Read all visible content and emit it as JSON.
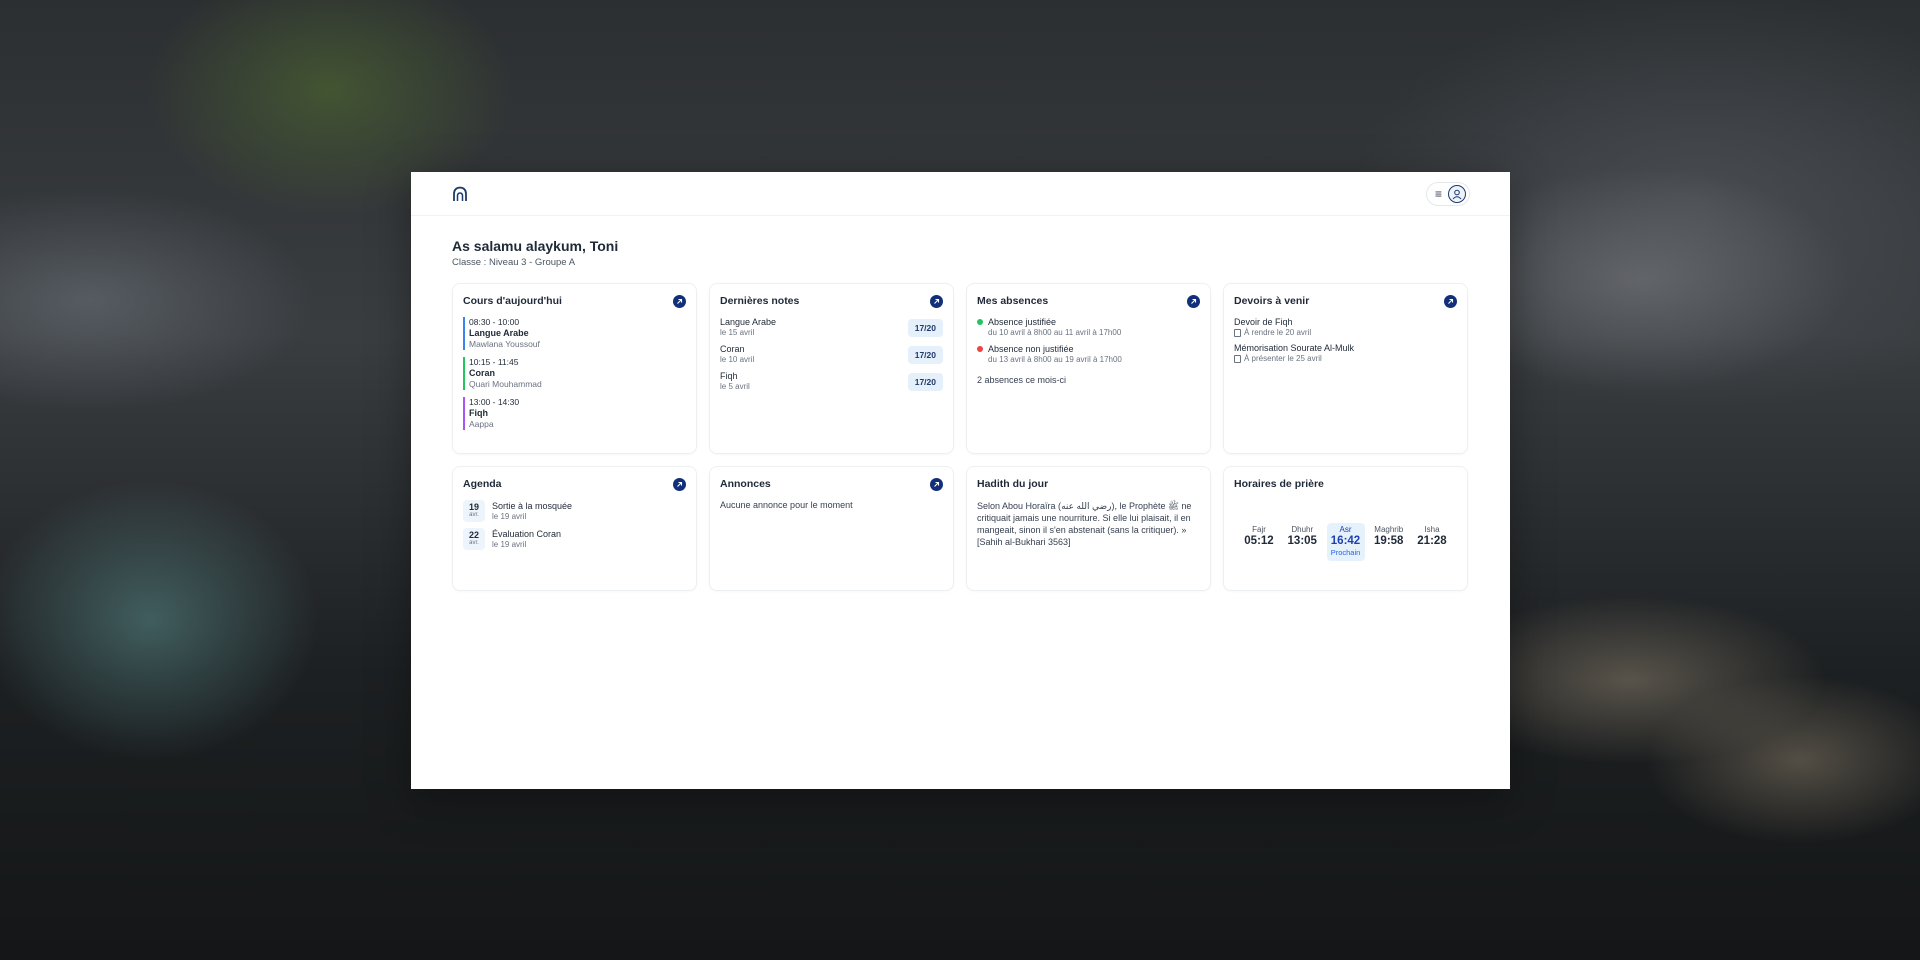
{
  "header": {
    "logo_icon": "mosque-arch-icon",
    "menu_icon": "hamburger-menu-icon",
    "avatar_icon": "user-avatar-icon"
  },
  "greeting": "As salamu alaykum, Toni",
  "classe": "Classe : Niveau 3 - Groupe A",
  "cards": {
    "cours": {
      "title": "Cours d'aujourd'hui",
      "items": [
        {
          "time": "08:30 - 10:00",
          "subject": "Langue Arabe",
          "teacher": "Mawlana Youssouf",
          "color": "#3b82f6"
        },
        {
          "time": "10:15 - 11:45",
          "subject": "Coran",
          "teacher": "Quari Mouhammad",
          "color": "#22c55e"
        },
        {
          "time": "13:00 - 14:30",
          "subject": "Fiqh",
          "teacher": "Aappa",
          "color": "#a855f7"
        }
      ]
    },
    "notes": {
      "title": "Dernières notes",
      "items": [
        {
          "subject": "Langue Arabe",
          "date": "le 15 avril",
          "grade": "17/20"
        },
        {
          "subject": "Coran",
          "date": "le 10 avril",
          "grade": "17/20"
        },
        {
          "subject": "Fiqh",
          "date": "le 5 avril",
          "grade": "17/20"
        }
      ]
    },
    "absences": {
      "title": "Mes absences",
      "items": [
        {
          "status": "Absence justifiée",
          "period": "du 10 avril à 8h00 au 11 avril à 17h00",
          "color": "#22c55e"
        },
        {
          "status": "Absence non justifiée",
          "period": "du 13 avril à 8h00 au 19 avril à 17h00",
          "color": "#ef4444"
        }
      ],
      "count": "2 absences ce mois-ci"
    },
    "devoirs": {
      "title": "Devoirs à venir",
      "items": [
        {
          "title": "Devoir de Fiqh",
          "due": "À rendre le 20 avril"
        },
        {
          "title": "Mémorisation Sourate Al-Mulk",
          "due": "À présenter le 25 avril"
        }
      ]
    },
    "agenda": {
      "title": "Agenda",
      "items": [
        {
          "day": "19",
          "month": "avr.",
          "title": "Sortie à la mosquée",
          "date": "le 19 avril"
        },
        {
          "day": "22",
          "month": "avr.",
          "title": "Évaluation Coran",
          "date": "le 19 avril"
        }
      ]
    },
    "annonces": {
      "title": "Annonces",
      "empty": "Aucune annonce pour le moment"
    },
    "hadith": {
      "title": "Hadith du jour",
      "text": "Selon Abou Horaïra (رضي الله عنه), le Prophète ﷺ ne critiquait jamais une nourriture. Si elle lui plaisait, il en mangeait, sinon il s'en abstenait (sans la critiquer). » [Sahih al-Bukhari 3563]"
    },
    "priere": {
      "title": "Horaires de prière",
      "items": [
        {
          "name": "Fajr",
          "time": "05:12"
        },
        {
          "name": "Dhuhr",
          "time": "13:05"
        },
        {
          "name": "Asr",
          "time": "16:42",
          "next": "Prochain"
        },
        {
          "name": "Maghrib",
          "time": "19:58"
        },
        {
          "name": "Isha",
          "time": "21:28"
        }
      ]
    }
  }
}
